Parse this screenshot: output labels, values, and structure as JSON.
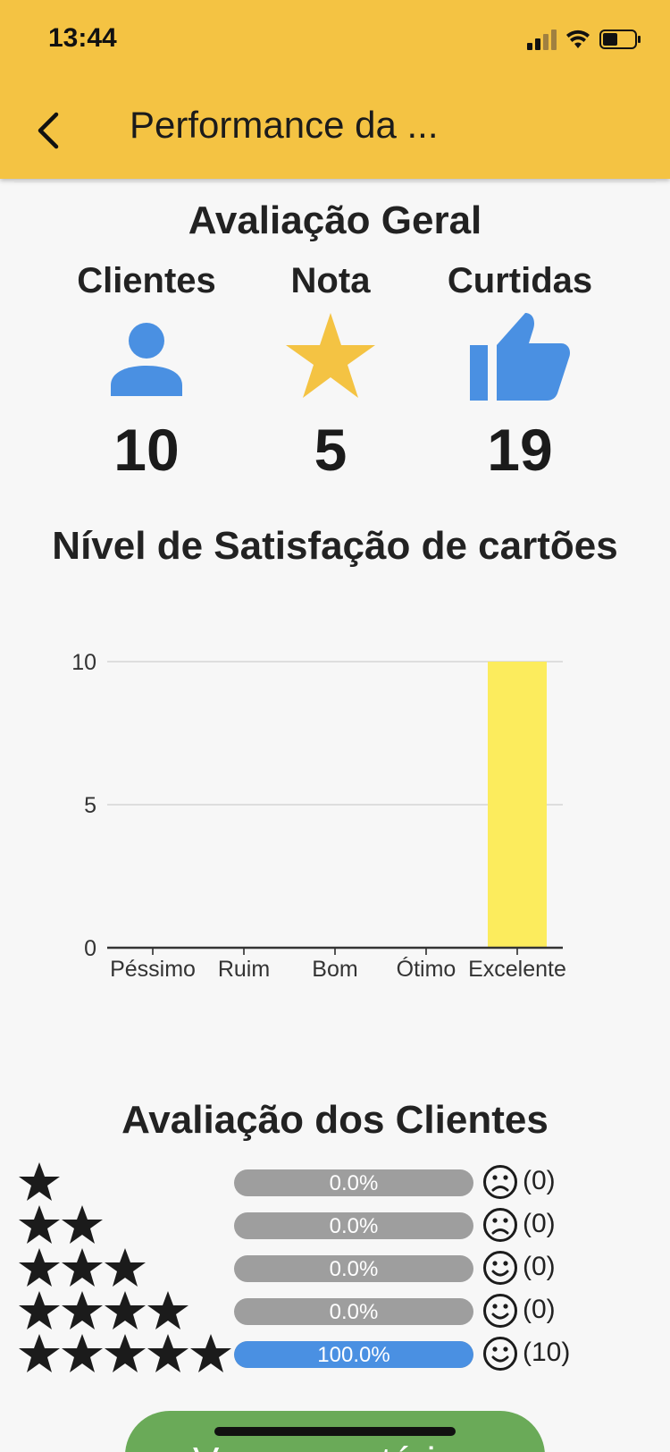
{
  "status_bar": {
    "time": "13:44"
  },
  "header": {
    "title": "Performance da ..."
  },
  "overview": {
    "title": "Avaliação Geral",
    "metrics": [
      {
        "label": "Clientes",
        "value": "10",
        "icon": "person-icon"
      },
      {
        "label": "Nota",
        "value": "5",
        "icon": "star-icon"
      },
      {
        "label": "Curtidas",
        "value": "19",
        "icon": "thumbs-up-icon"
      }
    ]
  },
  "satisfaction": {
    "title": "Nível de Satisfação de cartões"
  },
  "chart_data": {
    "type": "bar",
    "categories": [
      "Péssimo",
      "Ruim",
      "Bom",
      "Ótimo",
      "Excelente"
    ],
    "values": [
      0,
      0,
      0,
      0,
      10
    ],
    "ylim": [
      0,
      10
    ],
    "yticks": [
      "0",
      "5",
      "10"
    ],
    "grid": true,
    "bar_color": "#fcec5d"
  },
  "client_ratings": {
    "title": "Avaliação dos Clientes",
    "rows": [
      {
        "stars": 1,
        "percent_label": "0.0%",
        "fraction": 0,
        "count_label": "(0)",
        "face": "sad-face-icon"
      },
      {
        "stars": 2,
        "percent_label": "0.0%",
        "fraction": 0,
        "count_label": "(0)",
        "face": "sad-face-icon"
      },
      {
        "stars": 3,
        "percent_label": "0.0%",
        "fraction": 0,
        "count_label": "(0)",
        "face": "happy-face-icon"
      },
      {
        "stars": 4,
        "percent_label": "0.0%",
        "fraction": 0,
        "count_label": "(0)",
        "face": "happy-face-icon"
      },
      {
        "stars": 5,
        "percent_label": "100.0%",
        "fraction": 1,
        "count_label": "(10)",
        "face": "happy-face-icon"
      }
    ]
  },
  "actions": {
    "comments_button": "Ver comentários"
  },
  "colors": {
    "appbar": "#f4c343",
    "accent_blue": "#4a90e2",
    "star_yellow": "#f4c343",
    "bar_yellow": "#fcec5d",
    "button_green": "#6aaa58",
    "progress_gray": "#9e9e9e"
  }
}
